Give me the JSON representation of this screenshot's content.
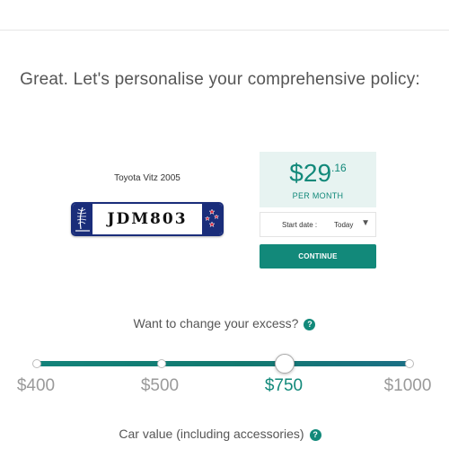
{
  "headline": "Great. Let's personalise your comprehensive policy:",
  "vehicle": {
    "name": "Toyota Vitz 2005",
    "plate": "JDM803"
  },
  "quote": {
    "price_main": "$29",
    "price_cents": ".16",
    "period": "PER MONTH"
  },
  "start_date": {
    "label": "Start date :",
    "value": "Today",
    "caret": "▼"
  },
  "continue_label": "CONTINUE",
  "excess": {
    "question": "Want to change your excess?",
    "help": "?",
    "options": [
      "$400",
      "$500",
      "$750",
      "$1000"
    ],
    "selected": "$750"
  },
  "car_value": {
    "question": "Car value (including accessories)",
    "help": "?"
  },
  "colors": {
    "accent": "#12897a",
    "price_bg": "#e7f3f1",
    "plate_blue": "#1a2d7a"
  }
}
